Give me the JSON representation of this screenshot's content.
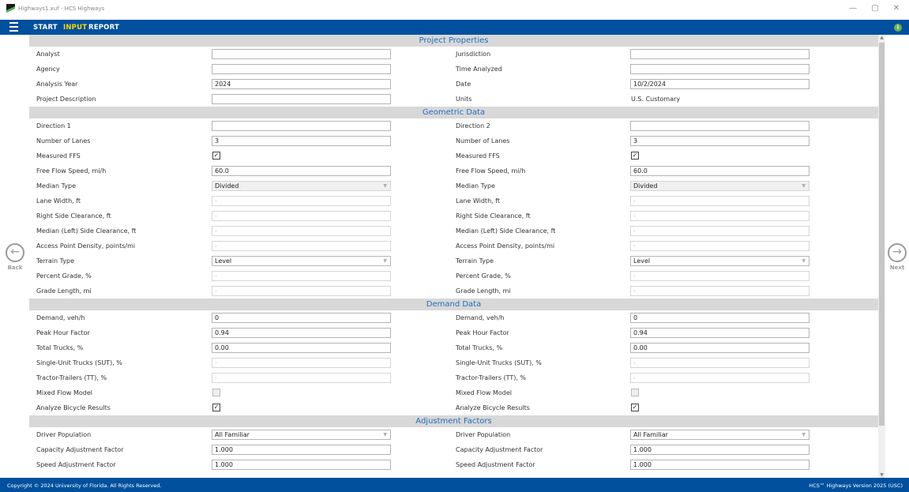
{
  "window": {
    "title": "Highways1.xuf - HCS Highways",
    "controls": {
      "minimize": "—",
      "restore": "▢",
      "close": "✕"
    }
  },
  "menu": {
    "items": [
      {
        "label": "START",
        "active": false
      },
      {
        "label": "INPUT",
        "active": true
      },
      {
        "label": "REPORT",
        "active": false
      }
    ],
    "info_glyph": "i"
  },
  "colors": {
    "primary": "#00509e",
    "active_menu": "#ffd800",
    "section_title": "#1f6fbf",
    "section_bg": "#d8d8d8"
  },
  "nav": {
    "back_label": "Back",
    "next_label": "Next",
    "back_glyph": "←",
    "next_glyph": "→"
  },
  "sections": [
    {
      "title": "Project Properties",
      "rows": [
        {
          "left": {
            "label": "Analyst",
            "type": "input",
            "value": ""
          },
          "right": {
            "label": "Jurisdiction",
            "type": "input",
            "value": ""
          }
        },
        {
          "left": {
            "label": "Agency",
            "type": "input",
            "value": ""
          },
          "right": {
            "label": "Time Analyzed",
            "type": "input",
            "value": ""
          }
        },
        {
          "left": {
            "label": "Analysis Year",
            "type": "input",
            "value": "2024"
          },
          "right": {
            "label": "Date",
            "type": "input",
            "value": "10/2/2024"
          }
        },
        {
          "left": {
            "label": "Project Description",
            "type": "input",
            "value": ""
          },
          "right": {
            "label": "Units",
            "type": "text",
            "value": "U.S. Customary"
          }
        }
      ]
    },
    {
      "title": "Geometric Data",
      "rows": [
        {
          "left": {
            "label": "Direction 1",
            "type": "input",
            "value": ""
          },
          "right": {
            "label": "Direction 2",
            "type": "input",
            "value": ""
          }
        },
        {
          "left": {
            "label": "Number of Lanes",
            "type": "input",
            "value": "3"
          },
          "right": {
            "label": "Number of Lanes",
            "type": "input",
            "value": "3"
          }
        },
        {
          "left": {
            "label": "Measured FFS",
            "type": "checkbox",
            "checked": true
          },
          "right": {
            "label": "Measured FFS",
            "type": "checkbox",
            "checked": true
          }
        },
        {
          "left": {
            "label": "Free Flow Speed, mi/h",
            "type": "input",
            "value": "60.0"
          },
          "right": {
            "label": "Free Flow Speed, mi/h",
            "type": "input",
            "value": "60.0"
          }
        },
        {
          "left": {
            "label": "Median Type",
            "type": "select-disabled",
            "value": "Divided"
          },
          "right": {
            "label": "Median Type",
            "type": "select-disabled",
            "value": "Divided"
          }
        },
        {
          "left": {
            "label": "Lane Width, ft",
            "type": "input-disabled",
            "value": "-"
          },
          "right": {
            "label": "Lane Width, ft",
            "type": "input-disabled",
            "value": "-"
          }
        },
        {
          "left": {
            "label": "Right Side Clearance, ft",
            "type": "input-disabled",
            "value": "-"
          },
          "right": {
            "label": "Right Side Clearance, ft",
            "type": "input-disabled",
            "value": "-"
          }
        },
        {
          "left": {
            "label": "Median (Left) Side Clearance, ft",
            "type": "input-disabled",
            "value": "-"
          },
          "right": {
            "label": "Median (Left) Side Clearance, ft",
            "type": "input-disabled",
            "value": "-"
          }
        },
        {
          "left": {
            "label": "Access Point Density, points/mi",
            "type": "input-disabled",
            "value": "-"
          },
          "right": {
            "label": "Access Point Density, points/mi",
            "type": "input-disabled",
            "value": "-"
          }
        },
        {
          "left": {
            "label": "Terrain Type",
            "type": "select",
            "value": "Level"
          },
          "right": {
            "label": "Terrain Type",
            "type": "select",
            "value": "Level"
          }
        },
        {
          "left": {
            "label": "Percent Grade, %",
            "type": "input-disabled",
            "value": "-"
          },
          "right": {
            "label": "Percent Grade, %",
            "type": "input-disabled",
            "value": "-"
          }
        },
        {
          "left": {
            "label": "Grade Length, mi",
            "type": "input-disabled",
            "value": "-"
          },
          "right": {
            "label": "Grade Length, mi",
            "type": "input-disabled",
            "value": "-"
          }
        }
      ]
    },
    {
      "title": "Demand Data",
      "rows": [
        {
          "left": {
            "label": "Demand, veh/h",
            "type": "input",
            "value": "0"
          },
          "right": {
            "label": "Demand, veh/h",
            "type": "input",
            "value": "0"
          }
        },
        {
          "left": {
            "label": "Peak Hour Factor",
            "type": "input",
            "value": "0.94"
          },
          "right": {
            "label": "Peak Hour Factor",
            "type": "input",
            "value": "0.94"
          }
        },
        {
          "left": {
            "label": "Total Trucks, %",
            "type": "input",
            "value": "0.00"
          },
          "right": {
            "label": "Total Trucks, %",
            "type": "input",
            "value": "0.00"
          }
        },
        {
          "left": {
            "label": "Single-Unit Trucks (SUT), %",
            "type": "input-disabled",
            "value": "-"
          },
          "right": {
            "label": "Single-Unit Trucks (SUT), %",
            "type": "input-disabled",
            "value": "-"
          }
        },
        {
          "left": {
            "label": "Tractor-Trailers (TT), %",
            "type": "input-disabled",
            "value": "-"
          },
          "right": {
            "label": "Tractor-Trailers (TT), %",
            "type": "input-disabled",
            "value": "-"
          }
        },
        {
          "left": {
            "label": "Mixed Flow Model",
            "type": "checkbox-disabled",
            "checked": false
          },
          "right": {
            "label": "Mixed Flow Model",
            "type": "checkbox-disabled",
            "checked": false
          }
        },
        {
          "left": {
            "label": "Analyze Bicycle Results",
            "type": "checkbox",
            "checked": true
          },
          "right": {
            "label": "Analyze Bicycle Results",
            "type": "checkbox",
            "checked": true
          }
        }
      ]
    },
    {
      "title": "Adjustment Factors",
      "rows": [
        {
          "left": {
            "label": "Driver Population",
            "type": "select",
            "value": "All Familiar"
          },
          "right": {
            "label": "Driver Population",
            "type": "select",
            "value": "All Familiar"
          }
        },
        {
          "left": {
            "label": "Capacity Adjustment Factor",
            "type": "input",
            "value": "1.000"
          },
          "right": {
            "label": "Capacity Adjustment Factor",
            "type": "input",
            "value": "1.000"
          }
        },
        {
          "left": {
            "label": "Speed Adjustment Factor",
            "type": "input",
            "value": "1.000"
          },
          "right": {
            "label": "Speed Adjustment Factor",
            "type": "input",
            "value": "1.000"
          }
        }
      ]
    }
  ],
  "footer": {
    "copyright": "Copyright © 2024 University of Florida. All Rights Reserved.",
    "version": "HCS™ Highways Version 2025 (USC)"
  }
}
